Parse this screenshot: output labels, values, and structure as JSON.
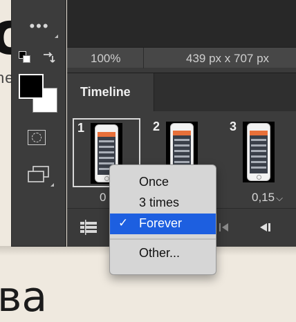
{
  "status_bar": {
    "zoom": "100%",
    "document_size": "439 px x 707 px"
  },
  "timeline": {
    "tab_label": "Timeline"
  },
  "frames": [
    {
      "number": "1",
      "delay": "0",
      "selected": true
    },
    {
      "number": "2",
      "delay": "",
      "selected": false
    },
    {
      "number": "3",
      "delay": "0,15",
      "selected": false
    }
  ],
  "loop_menu": {
    "items": [
      {
        "label": "Once",
        "checked": false
      },
      {
        "label": "3 times",
        "checked": false
      },
      {
        "label": "Forever",
        "checked": true
      }
    ],
    "other_label": "Other...",
    "check_glyph": "✓"
  },
  "delay_arrow_glyph": "⌵",
  "background_text": {
    "glyph": "o",
    "fragment": "ne",
    "word": "ва"
  },
  "swatches": {
    "foreground": "#000000",
    "background": "#ffffff"
  },
  "icons": {
    "more_tools": "more-tools-icon",
    "swap_colors": "swap-colors-icon",
    "quick_mask": "quick-mask-icon",
    "screen_mode": "screen-mode-icon",
    "convert_timeline": "convert-timeline-icon",
    "previous_frame": "previous-frame-icon",
    "first_frame": "first-frame-icon"
  }
}
